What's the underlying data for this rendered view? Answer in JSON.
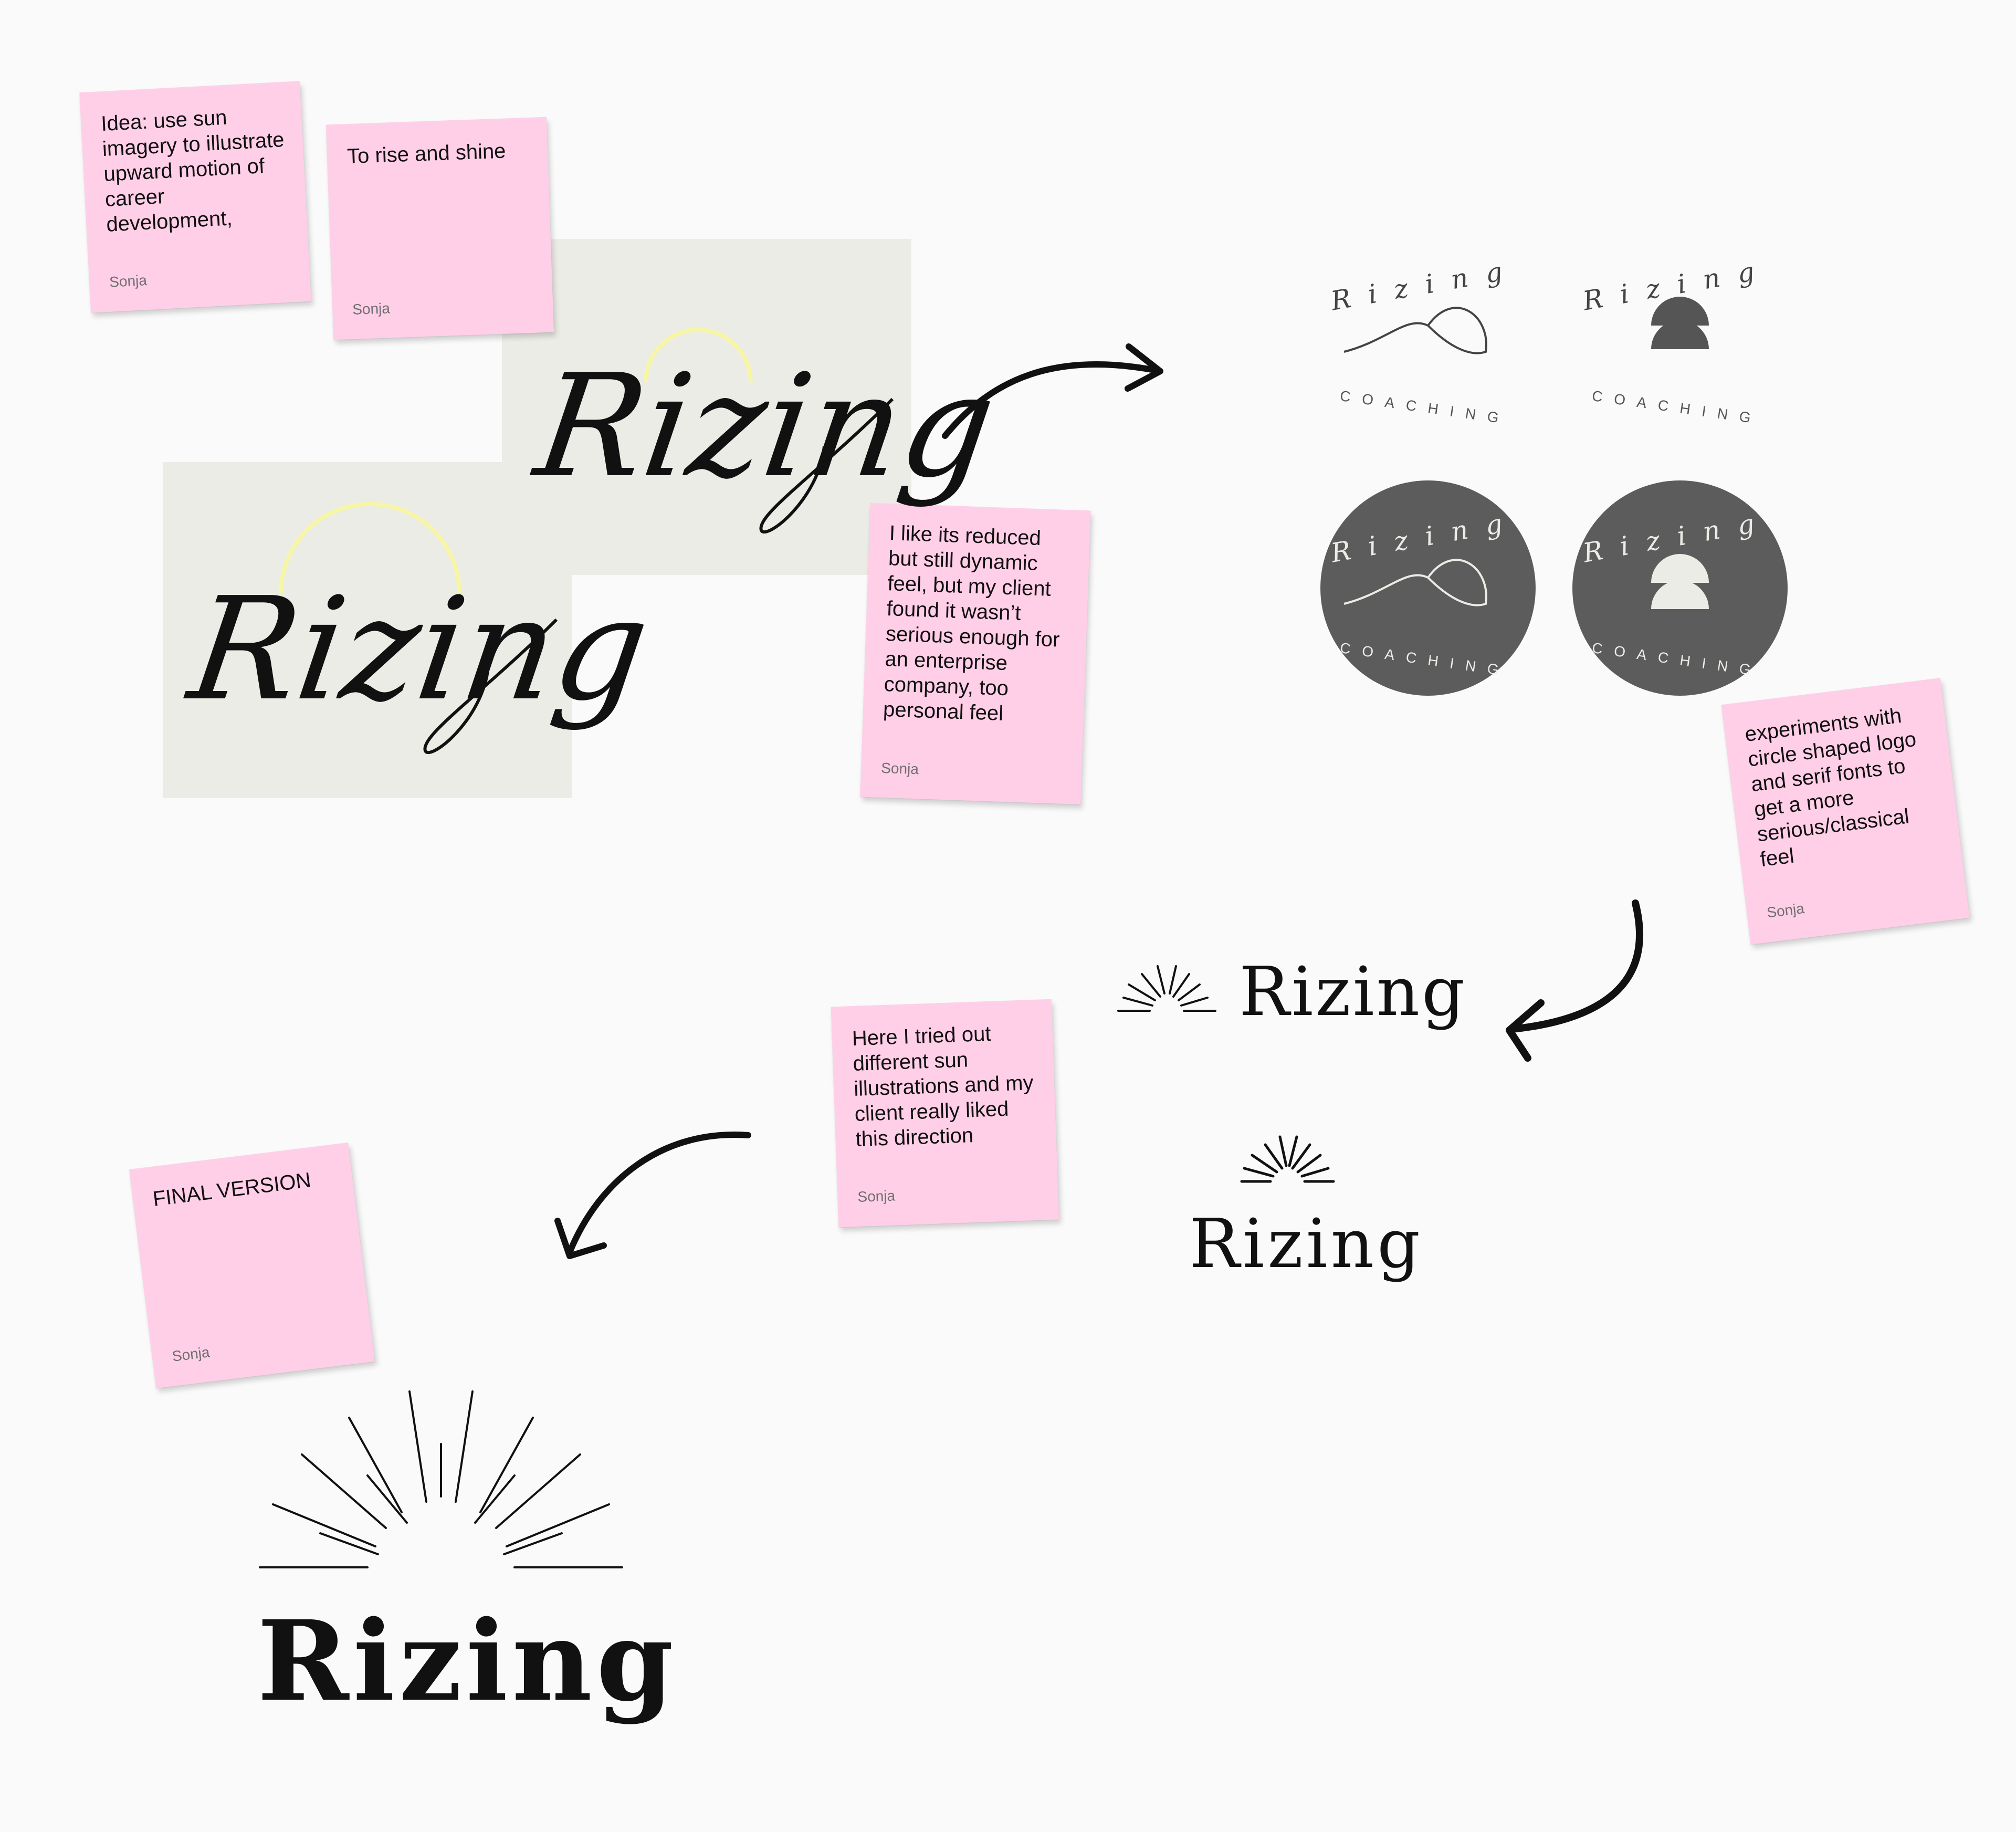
{
  "colors": {
    "board": "#fafafa",
    "sticky": "#ffcfe7",
    "card": "#ecece6",
    "sun_arc": "#f7f5a6",
    "badge": "#5c5c5c",
    "badge_shape": "#ecece6",
    "ink": "#111111",
    "author": "#6f6f6f"
  },
  "notes": [
    {
      "text": "Idea: use sun imagery to illustrate upward motion of career development,",
      "author": "Sonja"
    },
    {
      "text": "To rise and shine",
      "author": "Sonja"
    },
    {
      "text": "I like its reduced but still dynamic feel, but my client found it wasn’t serious enough for an enterprise company, too personal feel",
      "author": "Sonja"
    },
    {
      "text": "experiments with circle shaped logo and serif fonts to get a more serious/classical feel",
      "author": "Sonja"
    },
    {
      "text": "Here I tried out different sun illustrations and my client really liked this direction",
      "author": "Sonja"
    },
    {
      "text": "FINAL VERSION",
      "author": "Sonja"
    }
  ],
  "logos": {
    "script_wordmark": "Rizing",
    "circle_title": "Rizing",
    "circle_subtitle": "COACHING",
    "serif_wordmark": "Rizing",
    "final_wordmark": "Rizing"
  },
  "icons": [
    "curved-arrow-icon",
    "sun-arc-icon",
    "sun-rays-icon",
    "wave-sun-icon",
    "half-circle-sun-icon"
  ]
}
